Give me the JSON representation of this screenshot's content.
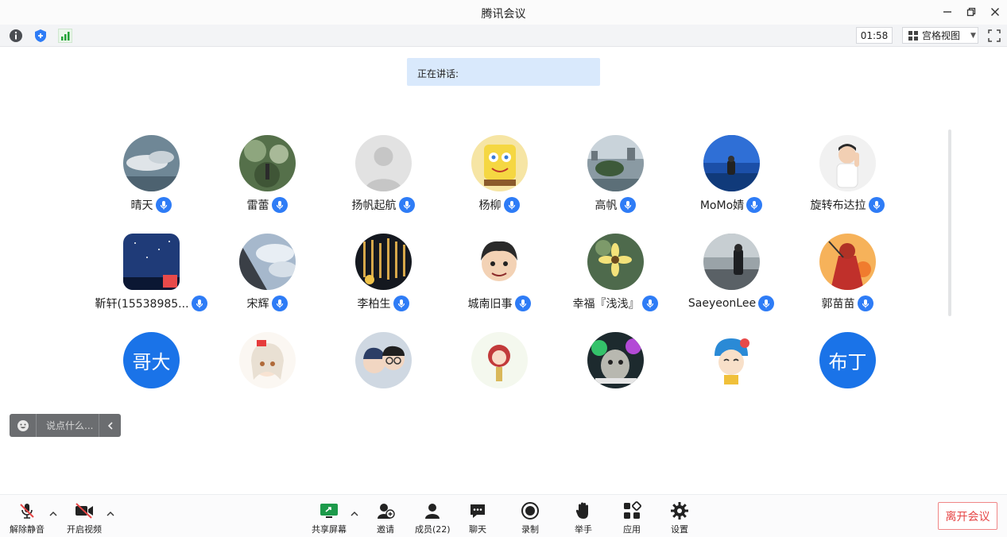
{
  "window": {
    "title": "腾讯会议"
  },
  "infobar": {
    "timer": "01:58",
    "view_label": "宫格视图"
  },
  "speaking": {
    "label": "正在讲话:"
  },
  "participants": [
    {
      "name": "晴天",
      "avatar": "cloud-sky"
    },
    {
      "name": "雷蕾",
      "avatar": "forest"
    },
    {
      "name": "扬帆起航",
      "avatar": "default-person"
    },
    {
      "name": "杨柳",
      "avatar": "spongebob"
    },
    {
      "name": "高帆",
      "avatar": "lake-city"
    },
    {
      "name": "MoMo婧",
      "avatar": "sea-girl"
    },
    {
      "name": "旋转布达拉",
      "avatar": "boy"
    },
    {
      "name": "靳轩(15538985...",
      "avatar": "night-sky"
    },
    {
      "name": "宋辉",
      "avatar": "sky-building"
    },
    {
      "name": "李柏生",
      "avatar": "calligraphy"
    },
    {
      "name": "城南旧事",
      "avatar": "cartoon-face"
    },
    {
      "name": "幸福『浅浅』",
      "avatar": "flower"
    },
    {
      "name": "SaeyeonLee",
      "avatar": "person-lake"
    },
    {
      "name": "郭苗苗",
      "avatar": "illustration-red"
    },
    {
      "name": "",
      "avatar_text": "哥大"
    },
    {
      "name": "",
      "avatar": "anime-girl"
    },
    {
      "name": "",
      "avatar": "couple-photo"
    },
    {
      "name": "",
      "avatar": "cartoon-girl"
    },
    {
      "name": "",
      "avatar": "cat-galaxy"
    },
    {
      "name": "",
      "avatar": "doraemon-girl"
    },
    {
      "name": "",
      "avatar_text": "布丁"
    }
  ],
  "chat": {
    "placeholder": "说点什么..."
  },
  "toolbar": {
    "unmute": "解除静音",
    "start_video": "开启视频",
    "share_screen": "共享屏幕",
    "invite": "邀请",
    "members": "成员(22)",
    "chat": "聊天",
    "record": "录制",
    "raise_hand": "举手",
    "apps": "应用",
    "settings": "设置",
    "leave": "离开会议"
  },
  "colors": {
    "accent": "#2e7cf6",
    "leave": "#e64545",
    "avatar_blue": "#1a73e8"
  }
}
